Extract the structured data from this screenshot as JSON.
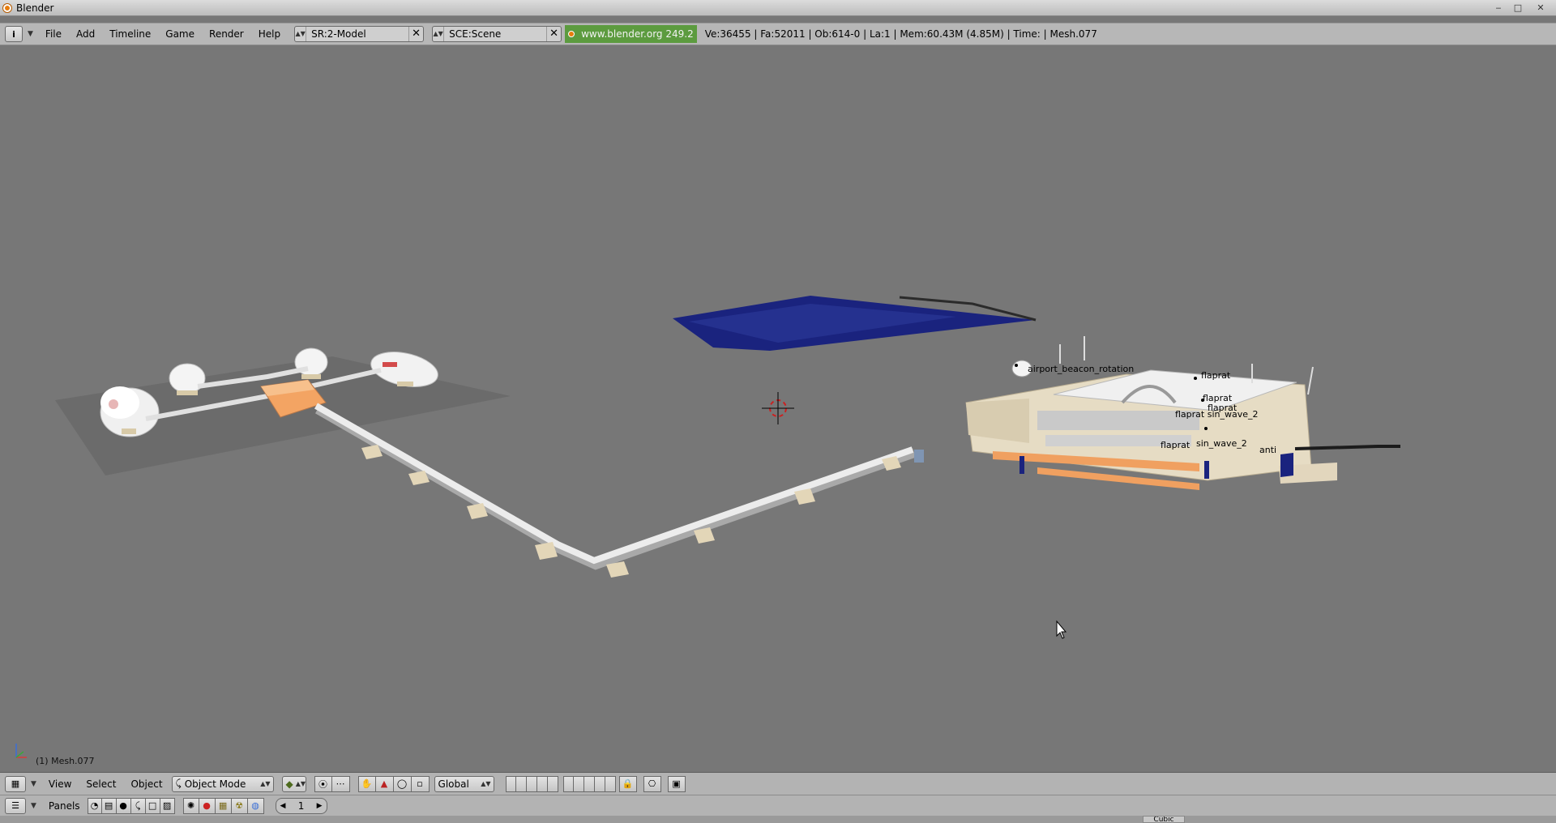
{
  "window": {
    "title": "Blender",
    "controls": {
      "minimize": "‒",
      "maximize": "□",
      "close": "✕"
    }
  },
  "infobar": {
    "menus": [
      "File",
      "Add",
      "Timeline",
      "Game",
      "Render",
      "Help"
    ],
    "screen_field": "SR:2-Model",
    "scene_field": "SCE:Scene",
    "weblink": "www.blender.org 249.2",
    "stats": "Ve:36455 | Fa:52011 | Ob:614-0 | La:1  | Mem:60.43M (4.85M)  | Time: | Mesh.077"
  },
  "viewport": {
    "object_info": "(1) Mesh.077",
    "labels": {
      "beacon": "airport_beacon_rotation",
      "flaprat_1": "flaprat",
      "flaprat_2": "flaprat",
      "flaprat_3": "flaprat",
      "flaprat_sin": "flaprat sin_wave_2",
      "flaprat_4": "flaprat",
      "sin_wave": "sin_wave_2",
      "anti": "anti"
    },
    "colors": {
      "background": "#777777",
      "tarmac": "#6a6a6a",
      "pipe": "#e8e8e8",
      "support": "#e0d3b4",
      "hub": "#f0a060",
      "building": "#e6dcc4",
      "crowd": "#1a237e"
    }
  },
  "header3d": {
    "menus": [
      "View",
      "Select",
      "Object"
    ],
    "mode": "Object Mode",
    "orientation": "Global"
  },
  "buttons_window": {
    "panels_label": "Panels",
    "frame": "1",
    "strip_label": "Cubic"
  }
}
